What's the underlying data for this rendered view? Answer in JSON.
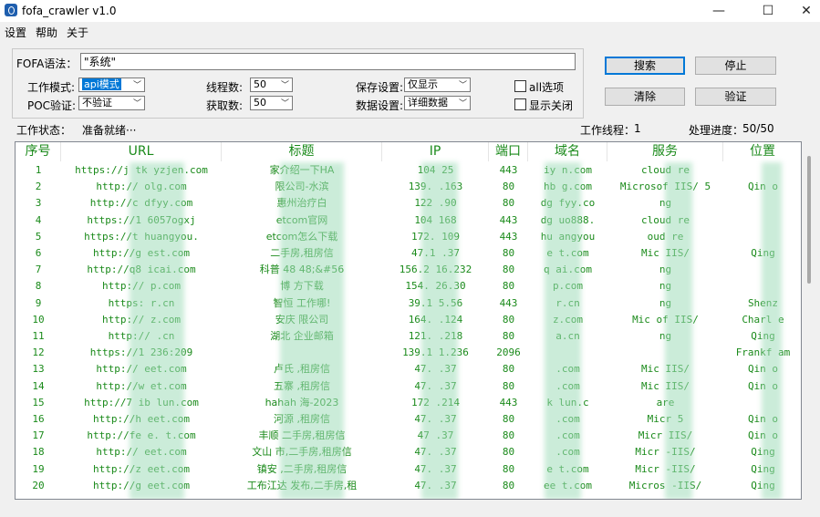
{
  "window": {
    "title": "fofa_crawler v1.0",
    "minimize": "—",
    "maximize": "☐",
    "close": "✕"
  },
  "menu": [
    "设置",
    "帮助",
    "关于"
  ],
  "form": {
    "query_label": "FOFA语法：",
    "query_value": "\"系统\"",
    "mode_label": "工作模式:",
    "mode_value": "api模式",
    "poc_label": "POC验证:",
    "poc_value": "不验证",
    "threads_label": "线程数:",
    "threads_value": "50",
    "fetch_label": "获取数:",
    "fetch_value": "50",
    "save_label": "保存设置:",
    "save_value": "仅显示",
    "data_label": "数据设置:",
    "data_value": "详细数据",
    "all_options_label": "all选项",
    "show_close_label": "显示关闭"
  },
  "buttons": {
    "search": "搜索",
    "stop": "停止",
    "clear": "清除",
    "verify": "验证"
  },
  "status": {
    "state_label": "工作状态：",
    "state_value": "准备就绪···",
    "threads_label": "工作线程：",
    "threads_value": "1",
    "progress_label": "处理进度：",
    "progress_value": "50/50"
  },
  "table": {
    "columns": [
      "序号",
      "URL",
      "标题",
      "IP",
      "端口",
      "域名",
      "服务",
      "位置"
    ],
    "rows": [
      [
        "1",
        "https://j     tk     yzjen.com",
        "       家介绍一下HA",
        "104       25",
        "443",
        "iy     n.com",
        "cloud   re",
        ""
      ],
      [
        "2",
        "http://      olg.com",
        "      限公司-水滨",
        "139.      .163",
        "80",
        "hb     g.com",
        "Microsof   IIS/   5",
        "Qin  o"
      ],
      [
        "3",
        "http://c      dfyy.com",
        "      惠州治疗白",
        "122      .90",
        "80",
        "dg     fyy.co",
        "ng",
        ""
      ],
      [
        "4",
        "https://1        6057ogxj",
        "      etcom官网",
        "104      168",
        "443",
        "dg     uo888.",
        "cloud   re",
        ""
      ],
      [
        "5",
        "https://t      huangyou.",
        "      etcom怎么下载",
        "172.      109",
        "443",
        "hu    angyou",
        "    oud   re",
        ""
      ],
      [
        "6",
        "http://g      est.com",
        "      二手房,租房信",
        "47.1      .37",
        "80",
        "e     t.com",
        "Mic    IIS/",
        "Qing"
      ],
      [
        "7",
        "http://q8      icai.com",
        "科普      48  48;&#56",
        "156.2      16.232",
        "80",
        "q     ai.com",
        "ng",
        ""
      ],
      [
        "8",
        "http://      p.com",
        "博     方下载",
        "154.      26.30",
        "80",
        "     p.com",
        "ng",
        ""
      ],
      [
        "9",
        "https:     r.cn",
        "智恒      工作哪!",
        "39.1      5.56",
        "443",
        "     r.cn",
        "ng",
        "Shenz"
      ],
      [
        "10",
        "http://      z.com",
        "安庆      限公司",
        "164.      .124",
        "80",
        "     z.com",
        "Mic   of   IIS/",
        "Charl  e"
      ],
      [
        "11",
        "http://      .cn",
        "湖北      企业邮箱",
        "121.      .218",
        "80",
        "     a.cn",
        "ng",
        "Qing"
      ],
      [
        "12",
        "https://1      236:209",
        "      ",
        "139.1      1.236",
        "2096",
        "",
        "",
        "Frankf   am"
      ],
      [
        "13",
        "http://      eet.com",
        "卢氏      ,租房信",
        "47.      .37",
        "80",
        "     .com",
        "Mic   IIS/",
        "Qin  o"
      ],
      [
        "14",
        "http://w      et.com",
        "五寨      ,租房信",
        "47.      .37",
        "80",
        "     .com",
        "Mic    IIS/",
        "Qin  o"
      ],
      [
        "15",
        "http://7      ib    lun.com",
        "hahah      海-2023",
        "172      .214",
        "443",
        "k     lun.c",
        "     are",
        ""
      ],
      [
        "16",
        "http://h      eet.com",
        "河源      ,租房信",
        "47.      .37",
        "80",
        "     .com",
        "Micr      5",
        "Qin  o"
      ],
      [
        "17",
        "http://fe      e.    t.com",
        "丰顺      二手房,租房信",
        "47      .37",
        "80",
        "     .com",
        "Micr     IIS/",
        "Qin  o"
      ],
      [
        "18",
        "http://      eet.com",
        "文山      市,二手房,租房信",
        "47.      .37",
        "80",
        "     .com",
        "Micr     -IIS/",
        "Qing"
      ],
      [
        "19",
        "http://z      eet.com",
        "镇安      ,二手房,租房信",
        "47.      .37",
        "80",
        "e     t.com",
        "Micr     -IIS/",
        "Qing"
      ],
      [
        "20",
        "http://g      eet.com",
        "工布江达      发布,二手房,租",
        "47.      .37",
        "80",
        "ee     t.com",
        "Micros   -IIS/",
        "Qing"
      ]
    ]
  }
}
